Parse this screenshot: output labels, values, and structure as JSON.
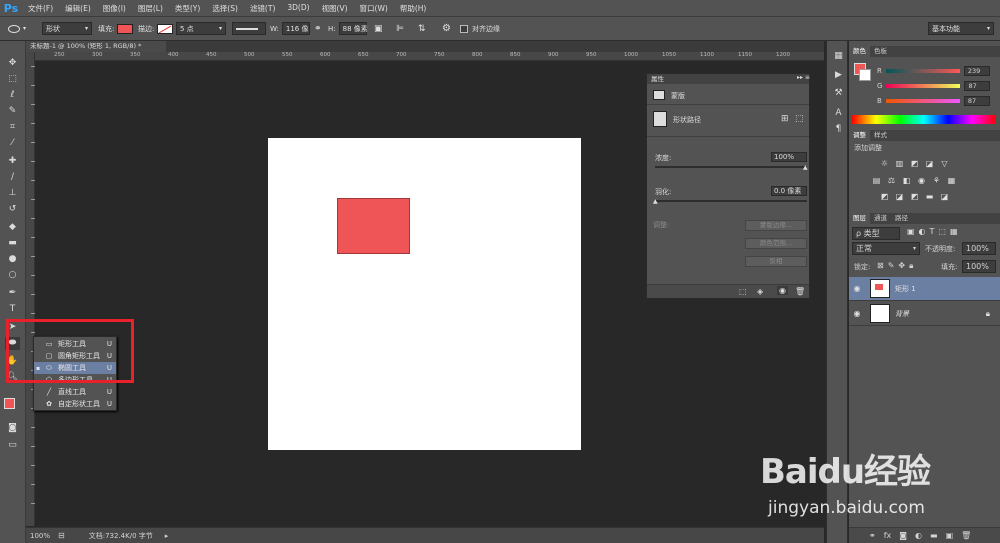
{
  "app": {
    "logo": "Ps"
  },
  "menu": [
    "文件(F)",
    "编辑(E)",
    "图像(I)",
    "图层(L)",
    "类型(Y)",
    "选择(S)",
    "滤镜(T)",
    "3D(D)",
    "视图(V)",
    "窗口(W)",
    "帮助(H)"
  ],
  "options": {
    "mode": "形状",
    "fill_label": "填充:",
    "fill_color": "#ef5456",
    "stroke_label": "描边:",
    "stroke_width": "5 点",
    "w_label": "W:",
    "w_value": "116 像",
    "h_label": "H:",
    "h_value": "88 像素",
    "align_edges": "对齐边缘",
    "workspace": "基本功能"
  },
  "document": {
    "tab_title": "未标题-1 @ 100% (矩形 1, RGB/8) *"
  },
  "ruler_top": [
    "250",
    "300",
    "350",
    "400",
    "450",
    "500",
    "550",
    "600",
    "650",
    "700",
    "750",
    "800",
    "850",
    "900",
    "950",
    "1000",
    "1050",
    "1100",
    "1150",
    "1200"
  ],
  "flyout": {
    "items": [
      {
        "label": "矩形工具",
        "shortcut": "U",
        "icon": "rectangle-icon"
      },
      {
        "label": "圆角矩形工具",
        "shortcut": "U",
        "icon": "rounded-rectangle-icon"
      },
      {
        "label": "椭圆工具",
        "shortcut": "U",
        "icon": "ellipse-icon",
        "selected": true
      },
      {
        "label": "多边形工具",
        "shortcut": "U",
        "icon": "polygon-icon"
      },
      {
        "label": "直线工具",
        "shortcut": "U",
        "icon": "line-icon"
      },
      {
        "label": "自定形状工具",
        "shortcut": "U",
        "icon": "custom-shape-icon"
      }
    ]
  },
  "properties": {
    "title": "属性",
    "section": "蒙版",
    "shape_path": "形状路径",
    "density_label": "浓度:",
    "density_value": "100%",
    "feather_label": "羽化:",
    "feather_value": "0.0 像素",
    "adjust_label": "调整:",
    "btn_mask_edge": "蒙版边缘...",
    "btn_color_range": "颜色范围...",
    "btn_invert": "反相"
  },
  "color_panel": {
    "tabs": [
      "颜色",
      "色板"
    ],
    "r_label": "R",
    "g_label": "G",
    "b_label": "B",
    "r": "239",
    "g": "87",
    "b": "87",
    "swatch": "#ef5757"
  },
  "adjustments": {
    "tabs": [
      "调整",
      "样式"
    ],
    "add_label": "添加调整"
  },
  "layers": {
    "tabs": [
      "图层",
      "通道",
      "路径"
    ],
    "filter_label": "ρ 类型",
    "blend_mode": "正常",
    "opacity_label": "不透明度:",
    "opacity_value": "100%",
    "lock_label": "锁定:",
    "fill_label": "填充:",
    "fill_value": "100%",
    "items": [
      {
        "name": "矩形 1",
        "selected": true
      },
      {
        "name": "背景",
        "selected": false
      }
    ]
  },
  "status": {
    "zoom": "100%",
    "doc_info": "文档:732.4K/0 字节"
  },
  "watermark": {
    "text": "Baidu经验",
    "url": "jingyan.baidu.com"
  }
}
